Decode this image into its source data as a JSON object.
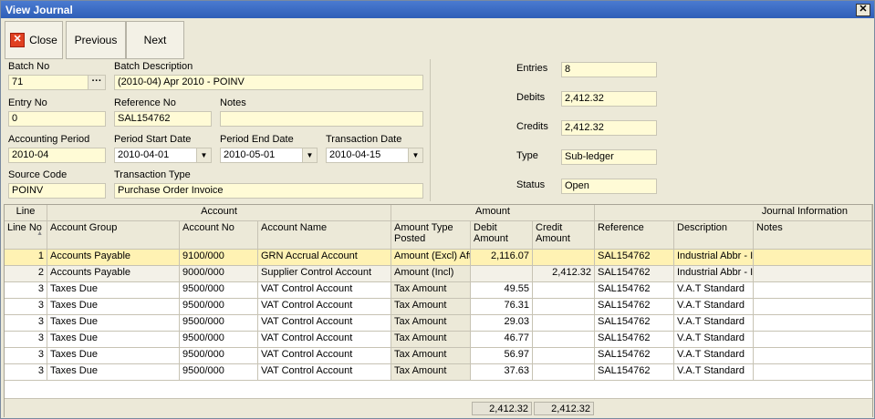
{
  "window": {
    "title": "View Journal",
    "close_glyph": "✕"
  },
  "toolbar": {
    "close_label": "Close",
    "previous_label": "Previous",
    "next_label": "Next"
  },
  "header": {
    "batch_no": {
      "label": "Batch No",
      "value": "71"
    },
    "batch_description": {
      "label": "Batch Description",
      "value": "(2010-04) Apr 2010 - POINV"
    },
    "entry_no": {
      "label": "Entry No",
      "value": "0"
    },
    "reference_no": {
      "label": "Reference No",
      "value": "SAL154762"
    },
    "notes": {
      "label": "Notes",
      "value": ""
    },
    "accounting_period": {
      "label": "Accounting Period",
      "value": "2010-04"
    },
    "period_start_date": {
      "label": "Period Start Date",
      "value": "2010-04-01"
    },
    "period_end_date": {
      "label": "Period End Date",
      "value": "2010-05-01"
    },
    "transaction_date": {
      "label": "Transaction Date",
      "value": "2010-04-15"
    },
    "source_code": {
      "label": "Source Code",
      "value": "POINV"
    },
    "transaction_type": {
      "label": "Transaction Type",
      "value": "Purchase Order Invoice"
    }
  },
  "summary": {
    "entries": {
      "label": "Entries",
      "value": "8"
    },
    "debits": {
      "label": "Debits",
      "value": "2,412.32"
    },
    "credits": {
      "label": "Credits",
      "value": "2,412.32"
    },
    "type": {
      "label": "Type",
      "value": "Sub-ledger"
    },
    "status": {
      "label": "Status",
      "value": "Open"
    }
  },
  "grid": {
    "groups": {
      "line": "Line",
      "account": "Account",
      "amount": "Amount",
      "journal": "Journal Information"
    },
    "columns": {
      "line_no": "Line No",
      "account_group": "Account Group",
      "account_no": "Account No",
      "account_name": "Account Name",
      "amount_type": "Amount Type Posted",
      "debit": "Debit Amount",
      "credit": "Credit Amount",
      "reference": "Reference",
      "description": "Description",
      "notes": "Notes"
    },
    "rows": [
      {
        "line": "1",
        "group": "Accounts Payable",
        "acct_no": "9100/000",
        "acct_name": "GRN Accrual Account",
        "amt_type": "Amount (Excl) Aft",
        "debit": "2,116.07",
        "credit": "",
        "ref": "SAL154762",
        "desc": "Industrial Abbr - If",
        "notes": ""
      },
      {
        "line": "2",
        "group": "Accounts Payable",
        "acct_no": "9000/000",
        "acct_name": "Supplier Control Account",
        "amt_type": "Amount (Incl)",
        "debit": "",
        "credit": "2,412.32",
        "ref": "SAL154762",
        "desc": "Industrial Abbr - If",
        "notes": ""
      },
      {
        "line": "3",
        "group": "Taxes Due",
        "acct_no": "9500/000",
        "acct_name": "VAT Control Account",
        "amt_type": "Tax Amount",
        "debit": "49.55",
        "credit": "",
        "ref": "SAL154762",
        "desc": "V.A.T Standard",
        "notes": ""
      },
      {
        "line": "3",
        "group": "Taxes Due",
        "acct_no": "9500/000",
        "acct_name": "VAT Control Account",
        "amt_type": "Tax Amount",
        "debit": "76.31",
        "credit": "",
        "ref": "SAL154762",
        "desc": "V.A.T Standard",
        "notes": ""
      },
      {
        "line": "3",
        "group": "Taxes Due",
        "acct_no": "9500/000",
        "acct_name": "VAT Control Account",
        "amt_type": "Tax Amount",
        "debit": "29.03",
        "credit": "",
        "ref": "SAL154762",
        "desc": "V.A.T Standard",
        "notes": ""
      },
      {
        "line": "3",
        "group": "Taxes Due",
        "acct_no": "9500/000",
        "acct_name": "VAT Control Account",
        "amt_type": "Tax Amount",
        "debit": "46.77",
        "credit": "",
        "ref": "SAL154762",
        "desc": "V.A.T Standard",
        "notes": ""
      },
      {
        "line": "3",
        "group": "Taxes Due",
        "acct_no": "9500/000",
        "acct_name": "VAT Control Account",
        "amt_type": "Tax Amount",
        "debit": "56.97",
        "credit": "",
        "ref": "SAL154762",
        "desc": "V.A.T Standard",
        "notes": ""
      },
      {
        "line": "3",
        "group": "Taxes Due",
        "acct_no": "9500/000",
        "acct_name": "VAT Control Account",
        "amt_type": "Tax Amount",
        "debit": "37.63",
        "credit": "",
        "ref": "SAL154762",
        "desc": "V.A.T Standard",
        "notes": ""
      }
    ],
    "totals": {
      "debit": "2,412.32",
      "credit": "2,412.32"
    }
  },
  "colors": {
    "selected_row": "#fff2b3",
    "field_bg": "#fffbd6",
    "title_bar": "#2f5fb8"
  }
}
